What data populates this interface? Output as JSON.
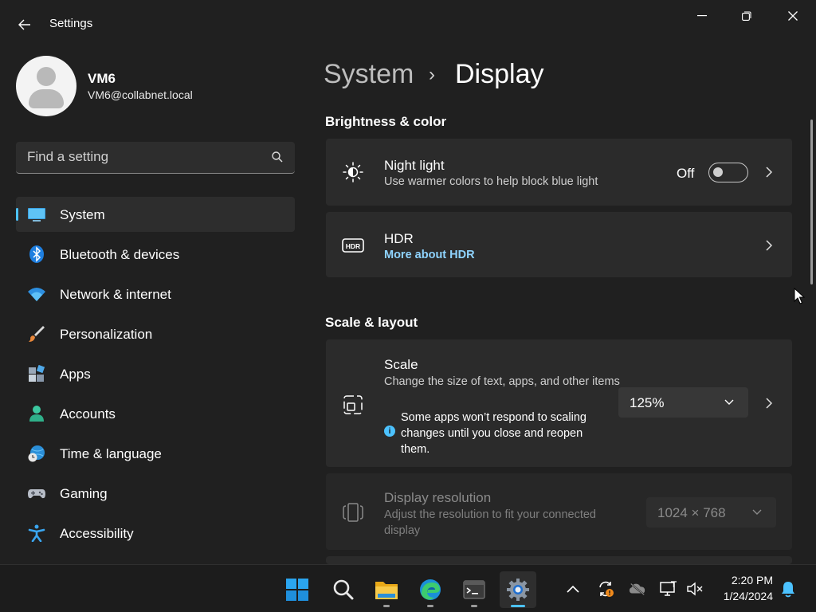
{
  "app": {
    "title": "Settings",
    "back_icon": "back-arrow-icon",
    "window_controls": [
      "minimize-icon",
      "restore-icon",
      "close-icon"
    ]
  },
  "profile": {
    "name": "VM6",
    "email": "VM6@collabnet.local"
  },
  "search": {
    "placeholder": "Find a setting",
    "icon": "search-icon"
  },
  "sidebar": {
    "active_index": 0,
    "accent": "#4cc2ff",
    "items": [
      {
        "label": "System",
        "icon": "system-icon"
      },
      {
        "label": "Bluetooth & devices",
        "icon": "bluetooth-icon"
      },
      {
        "label": "Network & internet",
        "icon": "wifi-icon"
      },
      {
        "label": "Personalization",
        "icon": "brush-icon"
      },
      {
        "label": "Apps",
        "icon": "apps-icon"
      },
      {
        "label": "Accounts",
        "icon": "accounts-icon"
      },
      {
        "label": "Time & language",
        "icon": "time-language-icon"
      },
      {
        "label": "Gaming",
        "icon": "gamepad-icon"
      },
      {
        "label": "Accessibility",
        "icon": "accessibility-icon"
      }
    ]
  },
  "breadcrumb": {
    "parent": "System",
    "separator": "›",
    "current": "Display"
  },
  "sections": {
    "brightness": {
      "title": "Brightness & color",
      "night_light": {
        "title": "Night light",
        "subtitle": "Use warmer colors to help block blue light",
        "state_label": "Off",
        "on": false
      },
      "hdr": {
        "title": "HDR",
        "link": "More about HDR"
      }
    },
    "scale_layout": {
      "title": "Scale & layout",
      "scale": {
        "title": "Scale",
        "subtitle": "Change the size of text, apps, and other items",
        "note": "Some apps won’t respond to scaling changes until you close and reopen them.",
        "value": "125%"
      },
      "resolution": {
        "title": "Display resolution",
        "subtitle": "Adjust the resolution to fit your connected display",
        "value": "1024 × 768",
        "disabled": true
      }
    }
  },
  "taskbar": {
    "apps": [
      "start-icon",
      "search-icon",
      "file-explorer-icon",
      "edge-icon",
      "terminal-icon",
      "settings-icon"
    ],
    "tray": [
      "chevron-up-icon",
      "sync-icon",
      "onedrive-icon",
      "display-icon",
      "volume-muted-icon"
    ],
    "time": "2:20 PM",
    "date": "1/24/2024",
    "notification_icon": "bell-icon"
  }
}
